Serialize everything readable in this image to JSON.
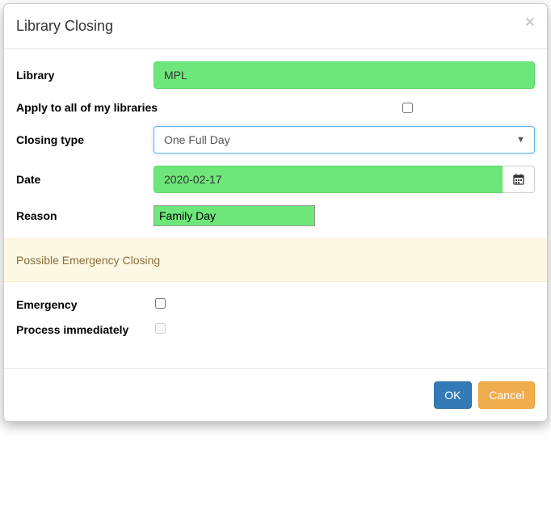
{
  "header": {
    "title": "Library Closing"
  },
  "form": {
    "library_label": "Library",
    "library_value": "MPL",
    "apply_all_label": "Apply to all of my libraries",
    "closing_type_label": "Closing type",
    "closing_type_value": "One Full Day",
    "date_label": "Date",
    "date_value": "2020-02-17",
    "reason_label": "Reason",
    "reason_value": "Family Day",
    "section_emergency": "Possible Emergency Closing",
    "emergency_label": "Emergency",
    "process_label": "Process immediately"
  },
  "footer": {
    "ok_label": "OK",
    "cancel_label": "Cancel"
  }
}
